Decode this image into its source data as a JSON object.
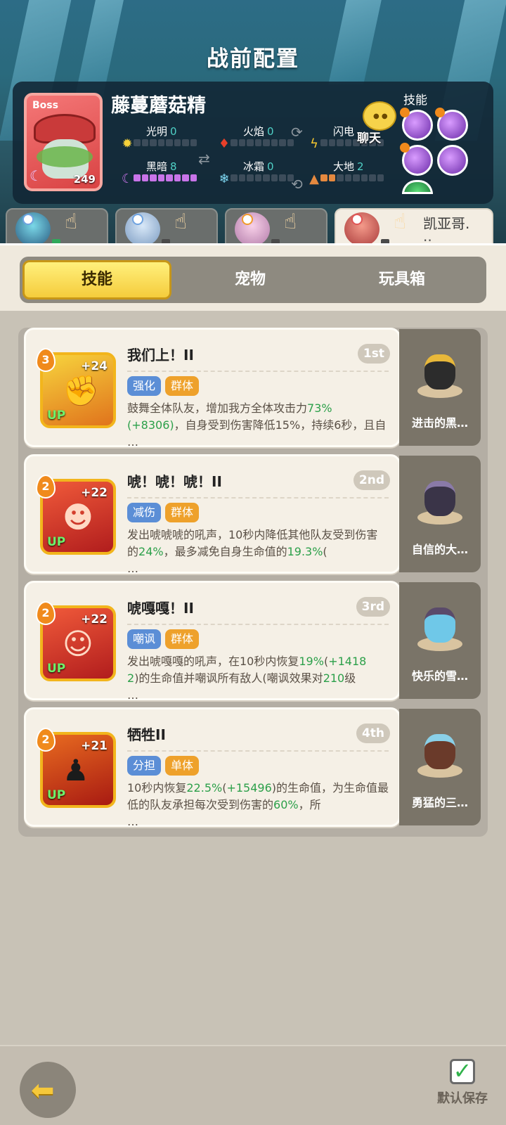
{
  "title": "战前配置",
  "boss": {
    "tag": "Boss",
    "level": "249",
    "name": "藤蔓蘑菇精",
    "elements": [
      {
        "label": "光明",
        "value": "0",
        "icon": "sun-icon"
      },
      {
        "label": "火焰",
        "value": "0",
        "icon": "fire-icon"
      },
      {
        "label": "闪电",
        "value": "",
        "icon": "lightning-icon"
      },
      {
        "label": "黑暗",
        "value": "8",
        "icon": "moon-icon"
      },
      {
        "label": "冰霜",
        "value": "0",
        "icon": "snowflake-icon"
      },
      {
        "label": "大地",
        "value": "2",
        "icon": "earth-icon"
      }
    ],
    "skills_label": "技能"
  },
  "chat": {
    "label": "聊天"
  },
  "team_tabs": [
    {
      "name": "",
      "active": false
    },
    {
      "name": "",
      "active": false
    },
    {
      "name": "",
      "active": false
    },
    {
      "name": "凯亚哥.",
      "extra": "..",
      "active": true
    }
  ],
  "segments": {
    "skills": "技能",
    "pets": "宠物",
    "toys": "玩具箱"
  },
  "cards": [
    {
      "level": "3",
      "plus": "+24",
      "up": "UP",
      "title": "我们上！II",
      "rank": "1st",
      "tags": [
        "强化",
        "群体"
      ],
      "desc_parts": [
        "鼓舞全体队友，增加我方全体攻击力",
        "73%",
        "(+83",
        "06)",
        "，自身受到伤害降低15%，持续6秒，且自",
        "…"
      ],
      "pet": "进击的黑…"
    },
    {
      "level": "2",
      "plus": "+22",
      "up": "UP",
      "title": "唬！唬！唬！II",
      "rank": "2nd",
      "tags": [
        "减伤",
        "群体"
      ],
      "desc_parts": [
        "发出唬唬唬的吼声，10秒内降低其他队友受到伤害的",
        "24%",
        "，最多减免自身生命值的",
        "19.3%",
        "(",
        "…"
      ],
      "pet": "自信的大…"
    },
    {
      "level": "2",
      "plus": "+22",
      "up": "UP",
      "title": "唬嘎嘎！II",
      "rank": "3rd",
      "tags": [
        "嘲讽",
        "群体"
      ],
      "desc_parts": [
        "发出唬嘎嘎的吼声，在10秒内恢复",
        "19%",
        "(",
        "+1418",
        "2",
        ")的生命值并嘲讽所有敌人(嘲讽效果对",
        "210",
        "级",
        "…"
      ],
      "pet": "快乐的雪…"
    },
    {
      "level": "2",
      "plus": "+21",
      "up": "UP",
      "title": "牺牲II",
      "rank": "4th",
      "tags": [
        "分担",
        "单体"
      ],
      "desc_parts": [
        "10秒内恢复",
        "22.5%",
        "(",
        "+15496",
        ")的生命值，为生命值最低的队友承担每次受到伤害的",
        "60%",
        "，所",
        "…"
      ],
      "pet": "勇猛的三…"
    }
  ],
  "bottom": {
    "default_save": "默认保存",
    "check": "✓"
  }
}
